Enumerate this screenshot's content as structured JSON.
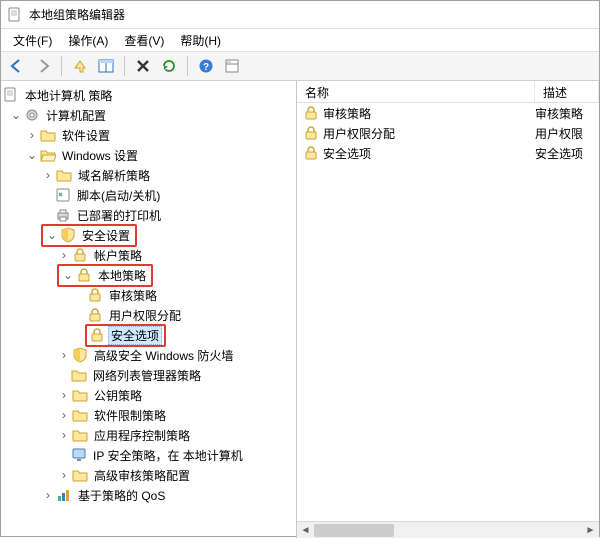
{
  "window": {
    "title": "本地组策略编辑器"
  },
  "menu": {
    "file": "文件(F)",
    "action": "操作(A)",
    "view": "查看(V)",
    "help": "帮助(H)"
  },
  "columns": {
    "name": "名称",
    "desc": "描述"
  },
  "list": {
    "items": [
      {
        "name": "审核策略",
        "desc": "审核策略"
      },
      {
        "name": "用户权限分配",
        "desc": "用户权限"
      },
      {
        "name": "安全选项",
        "desc": "安全选项"
      }
    ]
  },
  "tree": {
    "root": "本地计算机 策略",
    "computer_config": "计算机配置",
    "software_settings": "软件设置",
    "windows_settings": "Windows 设置",
    "dns_policy": "域名解析策略",
    "scripts": "脚本(启动/关机)",
    "printers": "已部署的打印机",
    "security_settings": "安全设置",
    "account_policies": "帐户策略",
    "local_policies": "本地策略",
    "audit_policy": "审核策略",
    "user_rights": "用户权限分配",
    "security_options": "安全选项",
    "firewall": "高级安全 Windows 防火墙",
    "nlm": "网络列表管理器策略",
    "public_key": "公钥策略",
    "software_restriction": "软件限制策略",
    "app_control": "应用程序控制策略",
    "ip_security": "IP 安全策略，在 本地计算机",
    "advanced_audit": "高级审核策略配置",
    "qos": "基于策略的 QoS"
  }
}
